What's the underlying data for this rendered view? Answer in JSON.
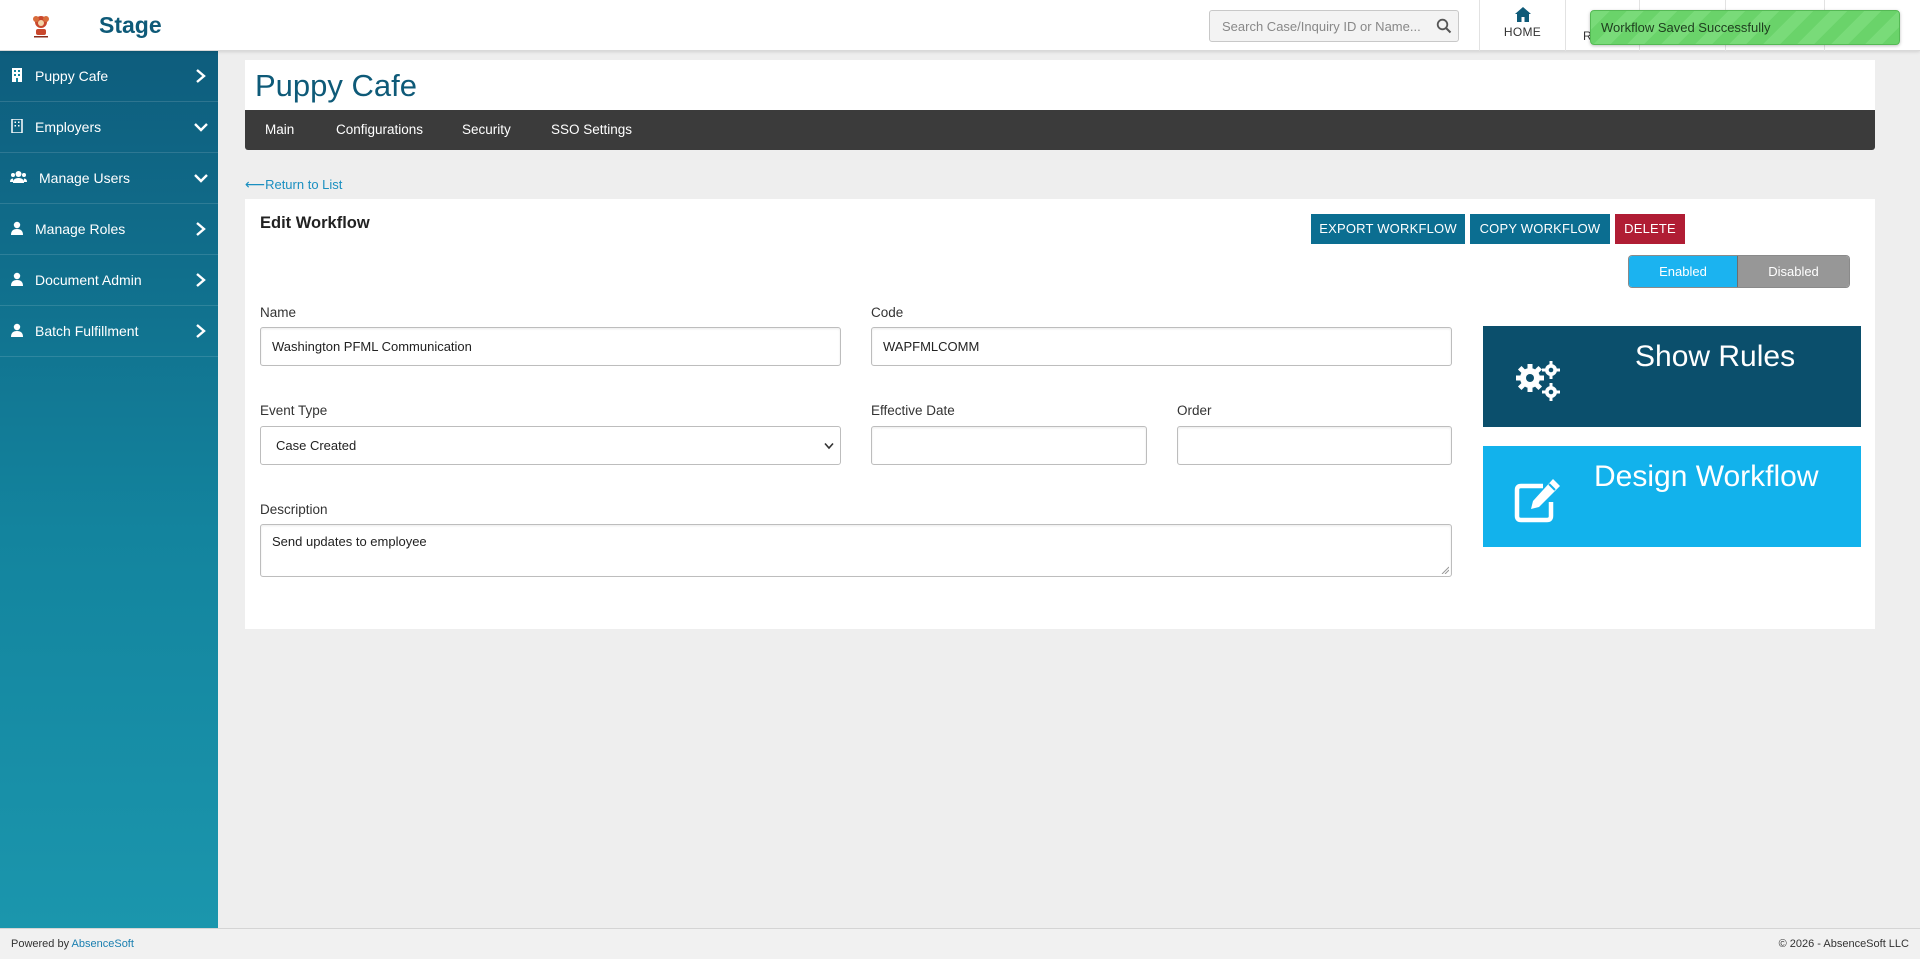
{
  "header": {
    "app_title": "Stage",
    "search_placeholder": "Search Case/Inquiry ID or Name...",
    "home_label": "HOME",
    "nav_partial_label": "R"
  },
  "toast": {
    "message": "Workflow Saved Successfully",
    "color": "#6ad36a"
  },
  "sidebar": {
    "items": [
      {
        "label": "Puppy Cafe",
        "icon": "building-icon",
        "chevron": "right"
      },
      {
        "label": "Employers",
        "icon": "building-icon",
        "chevron": "down"
      },
      {
        "label": "Manage Users",
        "icon": "users-icon",
        "chevron": "down"
      },
      {
        "label": "Manage Roles",
        "icon": "user-icon",
        "chevron": "right"
      },
      {
        "label": "Document Admin",
        "icon": "user-icon",
        "chevron": "right"
      },
      {
        "label": "Batch Fulfillment",
        "icon": "user-icon",
        "chevron": "right"
      }
    ]
  },
  "page": {
    "title": "Puppy Cafe",
    "tabs": [
      {
        "label": "Main"
      },
      {
        "label": "Configurations"
      },
      {
        "label": "Security"
      },
      {
        "label": "SSO Settings"
      }
    ],
    "return_link": "Return to List"
  },
  "workflow": {
    "heading": "Edit Workflow",
    "export_label": "EXPORT WORKFLOW",
    "copy_label": "COPY WORKFLOW",
    "delete_label": "DELETE",
    "toggle": {
      "enabled_label": "Enabled",
      "disabled_label": "Disabled",
      "selected": "Enabled"
    },
    "fields": {
      "name": {
        "label": "Name",
        "value": "Washington PFML Communication"
      },
      "code": {
        "label": "Code",
        "value": "WAPFMLCOMM"
      },
      "event_type": {
        "label": "Event Type",
        "value": "Case Created"
      },
      "effective_date": {
        "label": "Effective Date",
        "value": ""
      },
      "order": {
        "label": "Order",
        "value": ""
      },
      "description": {
        "label": "Description",
        "value": "Send updates to employee"
      }
    },
    "show_rules_label": "Show Rules",
    "design_workflow_label": "Design Workflow"
  },
  "footer": {
    "powered_by": "Powered by",
    "brand": "AbsenceSoft",
    "copyright": "© 2026 - AbsenceSoft LLC"
  },
  "colors": {
    "brand_dark": "#0e5a78",
    "tab_bar": "#3b3b3b",
    "primary_button": "#0b6e91",
    "danger_button": "#b01d34",
    "toggle_enabled": "#1bb3f0",
    "show_rules_bg": "#0b4f6c",
    "design_workflow_bg": "#12b2ec"
  }
}
